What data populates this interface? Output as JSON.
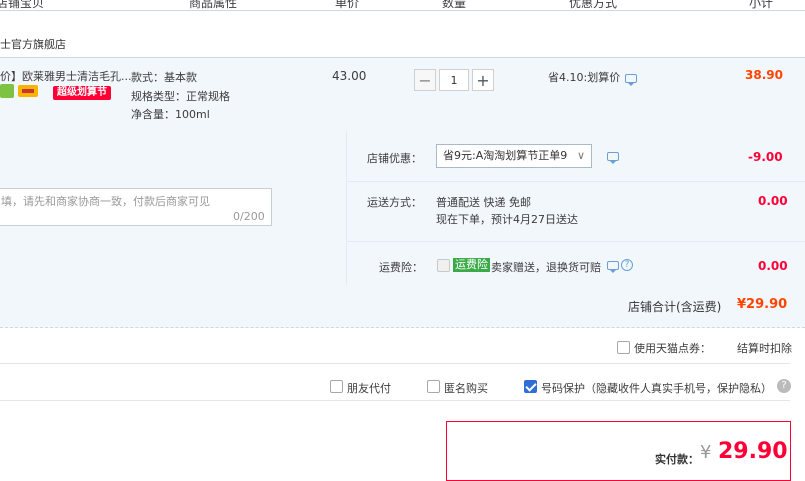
{
  "header": {
    "cols": [
      "店铺宝贝",
      "商品属性",
      "单价",
      "数量",
      "优惠方式",
      "小计"
    ]
  },
  "shop": {
    "name": "士官方旗舰店"
  },
  "item": {
    "title": "价】欧莱雅男士清洁毛孔...",
    "badge": "超级划算节",
    "attrs": [
      "款式：基本款",
      "规格类型：正常规格",
      "净含量：100ml"
    ],
    "price": "43.00",
    "qty": "1",
    "discount": "省4.10:划算价",
    "subtotal": "38.90"
  },
  "promo": {
    "shop_coupon_label": "店铺优惠：",
    "shop_coupon_value": "省9元:A淘淘划算节正单9",
    "shop_coupon_amount": "-9.00",
    "message_placeholder": "填，请先和商家协商一致，付款后商家可见",
    "message_counter": "0/200",
    "shipping_label": "运送方式：",
    "shipping_method": "普通配送 快递 免邮",
    "shipping_eta": "现在下单，预计4月27日送达",
    "shipping_amount": "0.00",
    "insurance_label": "运费险：",
    "insurance_tag": "运费险",
    "insurance_text": "卖家赠送，退换货可赔",
    "insurance_amount": "0.00"
  },
  "total": {
    "label": "店铺合计(含运费)",
    "value": "¥29.90"
  },
  "tmall_points": {
    "label": "使用天猫点券：",
    "note": "结算时扣除"
  },
  "options": {
    "friend_pay": "朋友代付",
    "anonymous": "匿名购买",
    "privacy": "号码保护（隐藏收件人真实手机号，保护隐私）"
  },
  "payment": {
    "label": "实付款：",
    "currency": "¥",
    "amount": "29.90"
  },
  "colors": {
    "accent": "#ff0036",
    "blue": "#2f6fd6",
    "bg": "#f2f7fc"
  }
}
